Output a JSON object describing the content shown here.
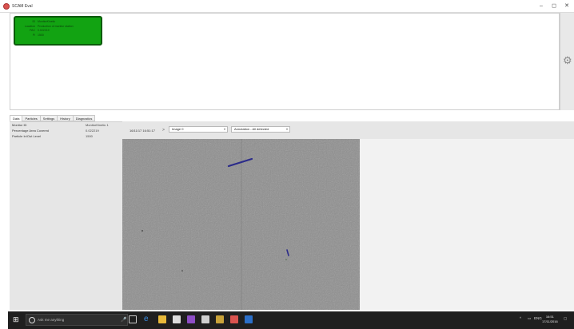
{
  "window": {
    "title": "SCAM Eval",
    "minimize": "–",
    "maximize": "◻",
    "close": "✕"
  },
  "status_card": {
    "rows": [
      {
        "key": "ID",
        "value": "MonitorKinetic"
      },
      {
        "key": "Location",
        "value": "Production of monitor station"
      },
      {
        "key": "PAC",
        "value": "0.022219"
      },
      {
        "key": "Pi",
        "value": "1500"
      }
    ],
    "color": "#12a312"
  },
  "tabs": [
    "Data",
    "Particles",
    "Settings",
    "History",
    "Diagnostics"
  ],
  "active_tab": "Data",
  "properties": [
    {
      "label": "Monitor ID",
      "value": "MonitorKinetic 1"
    },
    {
      "label": "Percentage Area Covered",
      "value": "0.022219"
    },
    {
      "label": "Particle In/Out Level",
      "value": "1500"
    }
  ],
  "toolbar": {
    "timestamp": "16/11/17 16:51:17",
    "nav": ">",
    "image_select": "Image 0",
    "annotation_select": "Annotation - All detected"
  },
  "taskbar": {
    "search_placeholder": "Ask me anything",
    "clock_time": "16:51",
    "clock_date": "17/11/2016",
    "language": "ENG"
  },
  "icons": {
    "settings": "gear-icon",
    "start": "windows-start-icon",
    "search": "search-icon"
  }
}
